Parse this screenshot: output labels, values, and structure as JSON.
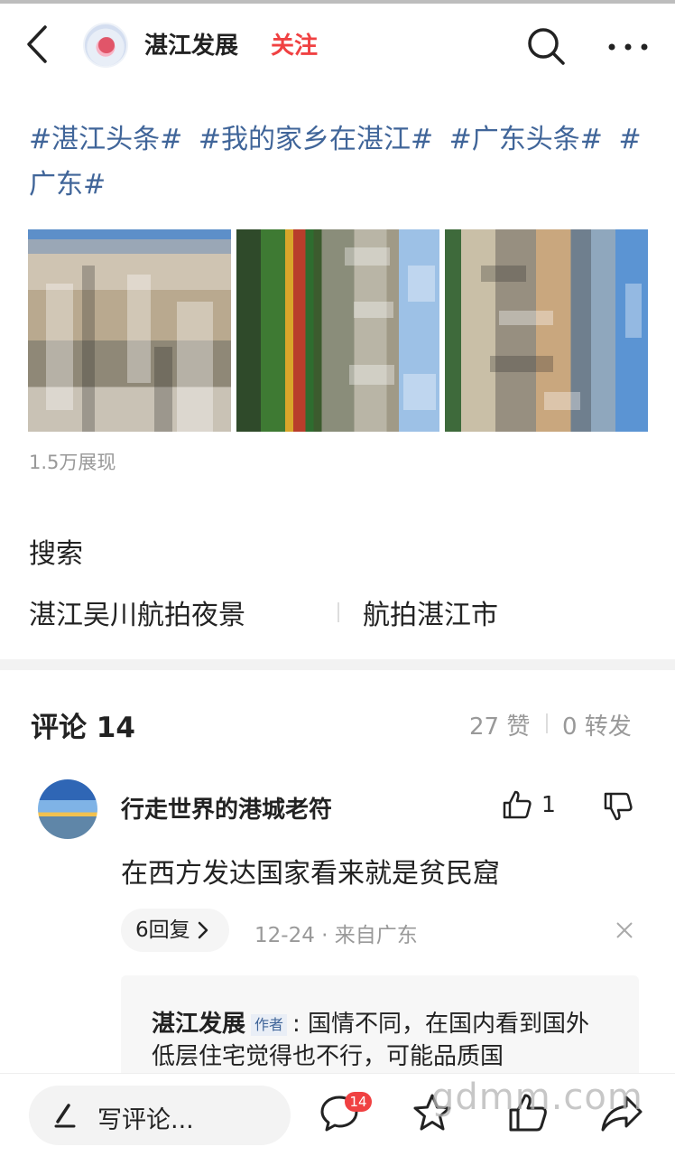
{
  "header": {
    "account_name": "湛江发展",
    "follow_label": "关注",
    "back_icon": "chevron-left-icon",
    "search_icon": "search-icon",
    "more_icon": "more-dots-icon"
  },
  "post": {
    "hashtags": [
      "#湛江头条#",
      "#我的家乡在湛江#",
      "#广东头条#",
      "#广东#"
    ],
    "views": "1.5万展现"
  },
  "search": {
    "title": "搜索",
    "suggestions": [
      "湛江吴川航拍夜景",
      "航拍湛江市"
    ]
  },
  "comments": {
    "title": "评论 14",
    "likes": "27 赞",
    "reposts": "0 转发",
    "items": [
      {
        "user": "行走世界的港城老符",
        "text": "在西方发达国家看来就是贫民窟",
        "like_count": "1",
        "replies_label": "6回复",
        "meta": "12-24 · 来自广东",
        "reply": {
          "author": "湛江发展",
          "badge": "作者",
          "text": ": 国情不同，在国内看到国外低层住宅觉得也不行，可能品质国"
        }
      }
    ]
  },
  "bottom_bar": {
    "write_label": "写评论...",
    "comment_badge": "14",
    "watermark": "gdmm.com"
  },
  "colors": {
    "link": "#406599",
    "follow": "#f04142",
    "badge": "#f04142"
  }
}
